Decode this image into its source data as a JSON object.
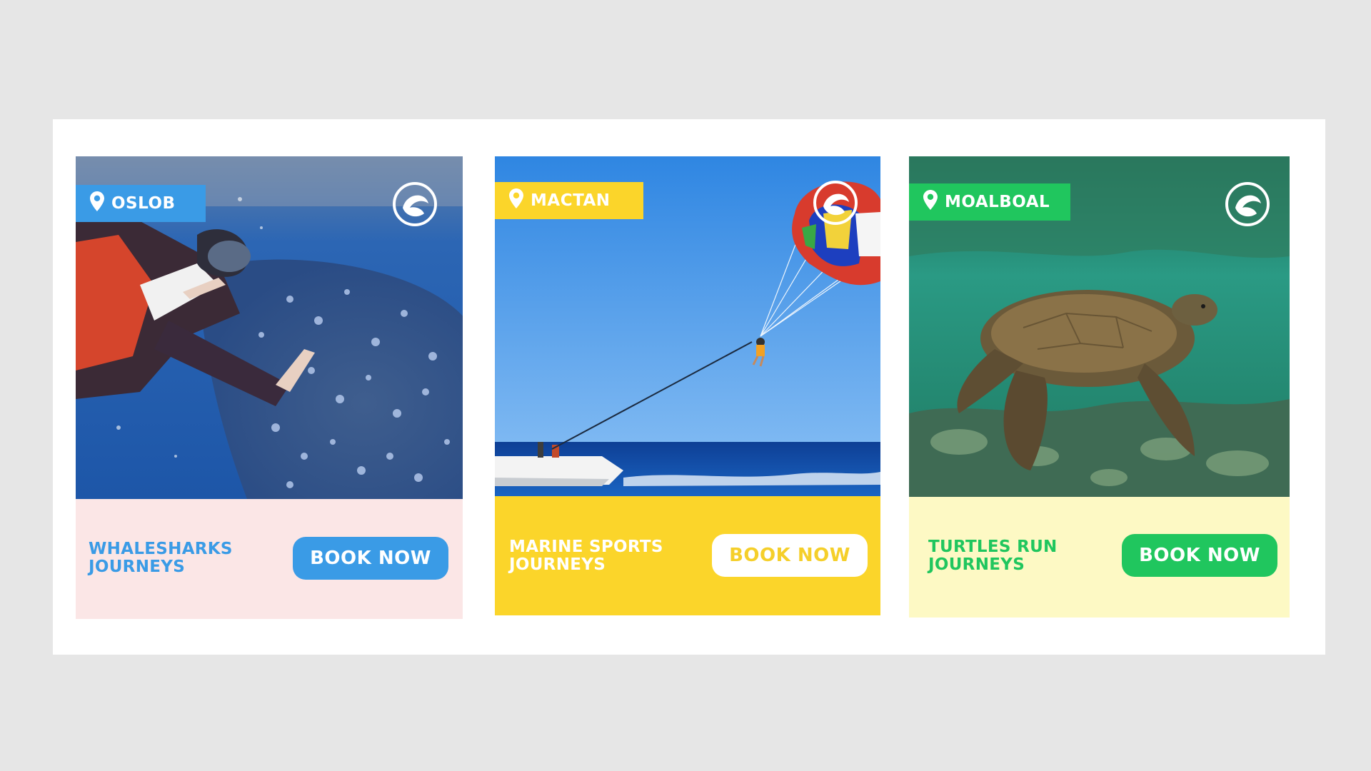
{
  "cards": [
    {
      "location": "OSLOB",
      "title_line1": "WHALESHARKS",
      "title_line2": "JOURNEYS",
      "button_label": "BOOK NOW",
      "photo": "whale-shark snorkeler",
      "colors": {
        "tag": "#3a9be6",
        "footer": "#fbe6e6",
        "title": "#3a9be6",
        "button_bg": "#3a9be6",
        "button_text": "#ffffff"
      }
    },
    {
      "location": "MACTAN",
      "title_line1": "MARINE SPORTS",
      "title_line2": "JOURNEYS",
      "button_label": "BOOK NOW",
      "photo": "parasailing over sea",
      "colors": {
        "tag": "#fbd52a",
        "footer": "#fbd52a",
        "title": "#ffffff",
        "button_bg": "#ffffff",
        "button_text": "#f5cf2a"
      }
    },
    {
      "location": "MOALBOAL",
      "title_line1": "TURTLES RUN",
      "title_line2": "JOURNEYS",
      "button_label": "BOOK NOW",
      "photo": "sea turtle over reef",
      "colors": {
        "tag": "#20c65e",
        "footer": "#fdf9c4",
        "title": "#20c65e",
        "button_bg": "#20c65e",
        "button_text": "#ffffff"
      }
    }
  ],
  "icons": {
    "location": "map-pin-icon",
    "brand": "brand-logo-icon"
  }
}
